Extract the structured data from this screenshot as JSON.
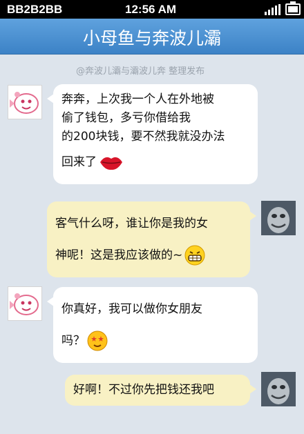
{
  "status_bar": {
    "carrier": "BB2B2BB",
    "time": "12:56 AM",
    "signal_icon": "signal-bars-icon",
    "battery_icon": "battery-full-icon"
  },
  "header": {
    "title": "小母鱼与奔波儿灞",
    "bar_color": "#4a8fd2"
  },
  "watermark": "@奔波儿灞与灞波儿奔 整理发布",
  "colors": {
    "background": "#dde4ec",
    "incoming_bubble": "#ffffff",
    "outgoing_bubble": "#f8f1c4"
  },
  "messages": [
    {
      "sender": "fish-girl",
      "side": "left",
      "avatar_icon": "pink-cartoon-fish-avatar",
      "lines": [
        "奔奔，上次我一个人在外地被",
        "偷了钱包，多亏你借给我",
        "的200块钱，要不然我就没办法",
        "回来了"
      ],
      "emoji": "red-lips-icon"
    },
    {
      "sender": "benbo",
      "side": "right",
      "avatar_icon": "grey-fish-monster-avatar",
      "lines": [
        "客气什么呀，谁让你是我的女",
        "神呢！这是我应该做的~"
      ],
      "emoji": "grin-emoji-icon"
    },
    {
      "sender": "fish-girl",
      "side": "left",
      "avatar_icon": "pink-cartoon-fish-avatar",
      "lines": [
        "你真好，我可以做你女朋友",
        "吗？"
      ],
      "emoji": "starry-eyed-emoji-icon"
    },
    {
      "sender": "benbo",
      "side": "right",
      "avatar_icon": "grey-fish-monster-avatar",
      "lines": [
        "好啊！不过你先把钱还我吧"
      ]
    }
  ]
}
